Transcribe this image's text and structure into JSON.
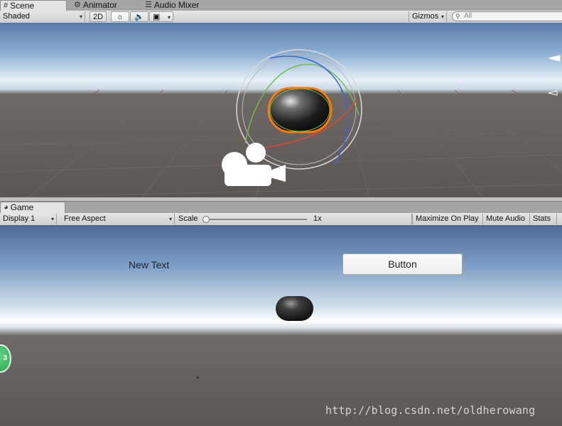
{
  "scene_tabs": [
    {
      "label": "Scene",
      "icon": "scene-grid-icon",
      "active": true
    },
    {
      "label": "Animator",
      "icon": "animator-icon",
      "active": false
    },
    {
      "label": "Audio Mixer",
      "icon": "audio-mixer-icon",
      "active": false
    }
  ],
  "scene_toolbar": {
    "shading_mode": "Shaded",
    "mode_2d": "2D",
    "gizmos": "Gizmos",
    "search_placeholder": "All"
  },
  "game_tabs": [
    {
      "label": "Game",
      "icon": "pacman-icon",
      "active": true
    }
  ],
  "game_toolbar": {
    "display": "Display 1",
    "aspect": "Free Aspect",
    "scale_label": "Scale",
    "scale_value": "1x",
    "maximize_on_play": "Maximize On Play",
    "mute_audio": "Mute Audio",
    "stats": "Stats"
  },
  "game_view": {
    "text_label": "New Text",
    "button_label": "Button",
    "badge_value": "3"
  },
  "watermark": "http://blog.csdn.net/oldherowang",
  "colors": {
    "selection_outline": "#ff7a00",
    "gizmo_red": "#e24a2a",
    "gizmo_green": "#6fbd4b",
    "gizmo_blue": "#3a66d4"
  }
}
